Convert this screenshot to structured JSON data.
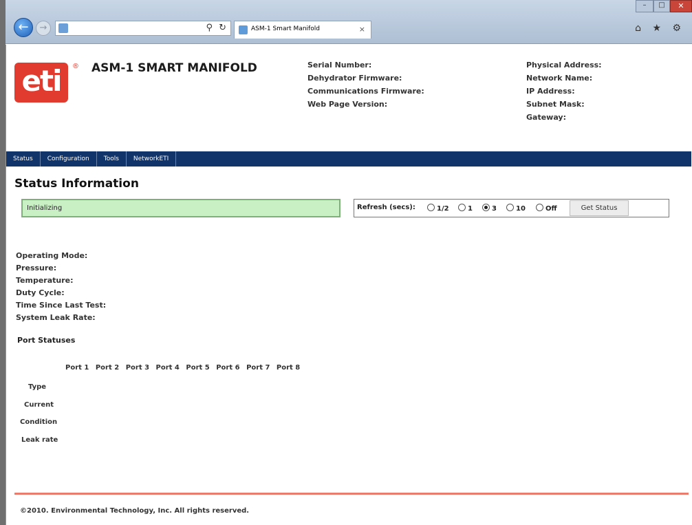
{
  "browser": {
    "tab_title": "ASM-1 Smart Manifold",
    "tab_close": "×",
    "search_glyph": "⚲",
    "refresh_glyph": "↻",
    "back_glyph": "←",
    "forward_glyph": "→",
    "minimize_glyph": "–",
    "maximize_glyph": "□",
    "close_glyph": "✕",
    "toolbar_glyphs": "⌂ ★ ⚙"
  },
  "header": {
    "logo_text": "eti",
    "registered_mark": "®",
    "product_title": "ASM-1 SMART MANIFOLD",
    "info_left": [
      "Serial Number:",
      "Dehydrator Firmware:",
      "Communications Firmware:",
      "Web Page Version:"
    ],
    "info_right": [
      "Physical Address:",
      "Network Name:",
      "IP Address:",
      "Subnet Mask:",
      "Gateway:"
    ]
  },
  "menu": [
    "Status",
    "Configuration",
    "Tools",
    "NetworkETI"
  ],
  "status": {
    "section_title": "Status Information",
    "message": "Initializing",
    "refresh_label": "Refresh (secs):",
    "refresh_options": [
      "1/2",
      "1",
      "3",
      "10",
      "Off"
    ],
    "refresh_selected": "3",
    "get_status_label": "Get Status"
  },
  "fields": [
    "Operating Mode:",
    "Pressure:",
    "Temperature:",
    "Duty Cycle:",
    "Time Since Last Test:",
    "System Leak Rate:"
  ],
  "ports": {
    "title": "Port Statuses",
    "headers": [
      "Port 1",
      "Port 2",
      "Port 3",
      "Port 4",
      "Port 5",
      "Port 6",
      "Port 7",
      "Port 8"
    ],
    "rows": [
      "Type",
      "Current",
      "Condition",
      "Leak rate"
    ]
  },
  "footer": {
    "copyright": "©2010. Environmental Technology, Inc. All rights reserved."
  }
}
